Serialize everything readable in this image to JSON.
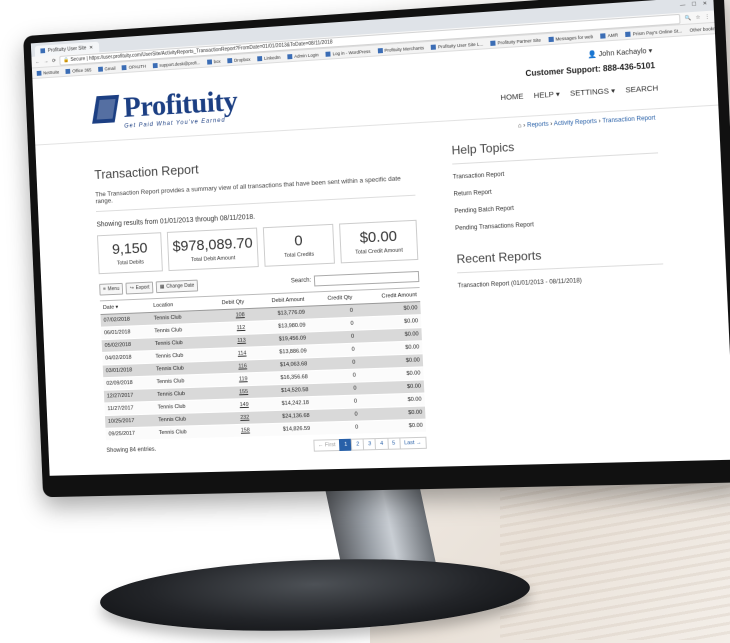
{
  "browser": {
    "tab_title": "Profituity User Site",
    "secure_label": "Secure",
    "url": "https://user.profituity.com/UserSite/ActivityReports_TransactionReport?FromDate=01/01/2013&ToDate=08/11/2018",
    "bookmarks": [
      "NetSuite",
      "Office 365",
      "Gmail",
      "OPAUTH",
      "support.desk@profi...",
      "box",
      "Dropbox",
      "LinkedIn",
      "Admin Login",
      "Log in - WordPress",
      "Profituity Merchants",
      "Profituity User Site L...",
      "Profituity Partner Site",
      "Messages for web",
      "AMR",
      "Prism Pay's Online St..."
    ],
    "other_bookmarks": "Other bookmarks"
  },
  "header": {
    "logo_text": "Profituity",
    "tagline": "Get Paid What You've Earned",
    "user_name": "John Kachaylo",
    "support_label": "Customer Support:",
    "support_phone": "888-436-5101",
    "nav": [
      "HOME",
      "HELP",
      "SETTINGS",
      "SEARCH"
    ]
  },
  "breadcrumb": {
    "home_icon": "home-icon",
    "items": [
      "Reports",
      "Activity Reports",
      "Transaction Report"
    ]
  },
  "report": {
    "title": "Transaction Report",
    "description": "The Transaction Report provides a summary view of all transactions that have been sent within a specific date range.",
    "showing": "Showing results from 01/01/2013 through 08/11/2018.",
    "stats": [
      {
        "value": "9,150",
        "label": "Total Debits"
      },
      {
        "value": "$978,089.70",
        "label": "Total Debit Amount"
      },
      {
        "value": "0",
        "label": "Total Credits"
      },
      {
        "value": "$0.00",
        "label": "Total Credit Amount"
      }
    ],
    "buttons": {
      "menu": "Menu",
      "export": "Export",
      "change_date": "Change Date"
    },
    "search_label": "Search:",
    "columns": [
      "Date",
      "Location",
      "Debit Qty",
      "Debit Amount",
      "Credit Qty",
      "Credit Amount"
    ],
    "rows": [
      [
        "07/02/2018",
        "Tennis Club",
        "108",
        "$13,776.09",
        "0",
        "$0.00"
      ],
      [
        "06/01/2018",
        "Tennis Club",
        "112",
        "$13,980.09",
        "0",
        "$0.00"
      ],
      [
        "05/02/2018",
        "Tennis Club",
        "113",
        "$19,456.09",
        "0",
        "$0.00"
      ],
      [
        "04/02/2018",
        "Tennis Club",
        "114",
        "$13,886.09",
        "0",
        "$0.00"
      ],
      [
        "03/01/2018",
        "Tennis Club",
        "116",
        "$14,063.68",
        "0",
        "$0.00"
      ],
      [
        "02/09/2018",
        "Tennis Club",
        "119",
        "$16,356.68",
        "0",
        "$0.00"
      ],
      [
        "12/27/2017",
        "Tennis Club",
        "155",
        "$14,520.58",
        "0",
        "$0.00"
      ],
      [
        "11/27/2017",
        "Tennis Club",
        "149",
        "$14,242.18",
        "0",
        "$0.00"
      ],
      [
        "10/25/2017",
        "Tennis Club",
        "232",
        "$24,136.68",
        "0",
        "$0.00"
      ],
      [
        "09/25/2017",
        "Tennis Club",
        "158",
        "$14,826.59",
        "0",
        "$0.00"
      ]
    ],
    "entries": "Showing 84 entries.",
    "pager": [
      "← First",
      "1",
      "2",
      "3",
      "4",
      "5",
      "Last →"
    ]
  },
  "sidebar": {
    "help_title": "Help Topics",
    "help_links": [
      "Transaction Report",
      "Return Report",
      "Pending Batch Report",
      "Pending Transactions Report"
    ],
    "recent_title": "Recent Reports",
    "recent_links": [
      "Transaction Report (01/01/2013 - 08/11/2018)"
    ]
  },
  "colors": {
    "brand": "#1c3f83",
    "link": "#2860a8"
  }
}
